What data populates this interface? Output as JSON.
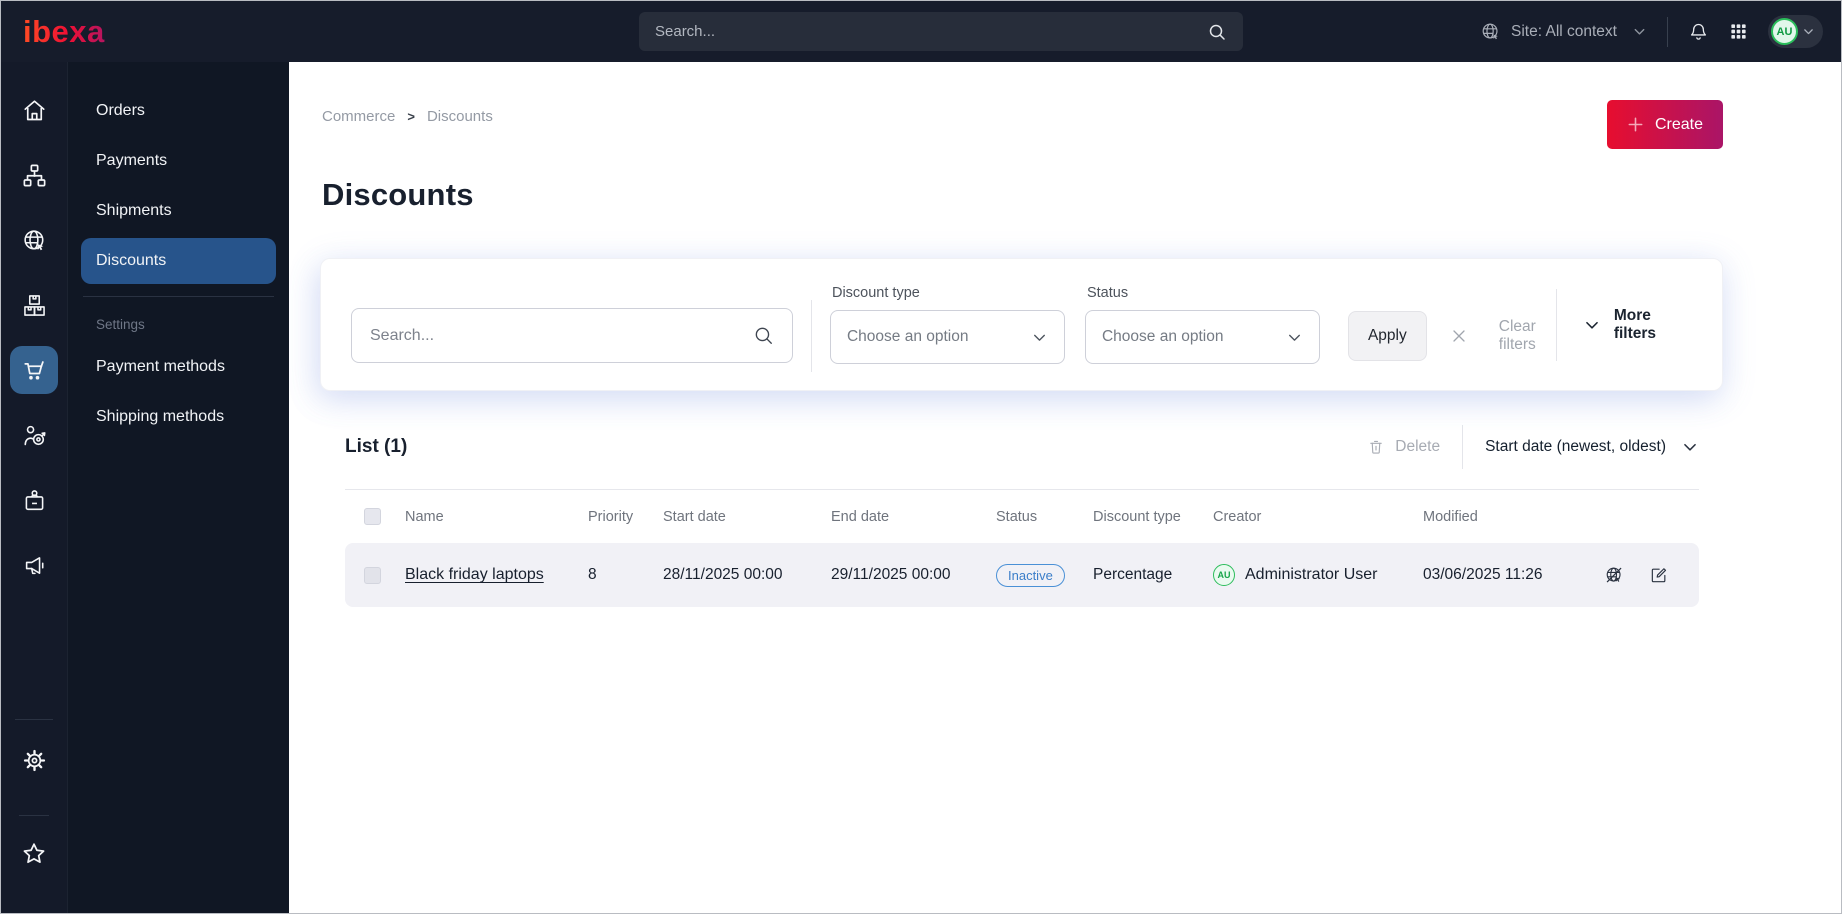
{
  "topbar": {
    "logo_text": "ibexa",
    "search": {
      "placeholder": "Search..."
    },
    "site_context": {
      "label": "Site: All context"
    },
    "avatar_initials": "AU"
  },
  "menu": {
    "items": [
      {
        "label": "Orders"
      },
      {
        "label": "Payments"
      },
      {
        "label": "Shipments"
      },
      {
        "label": "Discounts"
      }
    ],
    "section_label": "Settings",
    "settings_items": [
      {
        "label": "Payment methods"
      },
      {
        "label": "Shipping methods"
      }
    ]
  },
  "breadcrumb": {
    "items": [
      "Commerce",
      "Discounts"
    ],
    "separator": ">"
  },
  "page": {
    "title": "Discounts",
    "create_label": "Create"
  },
  "filters": {
    "search_placeholder": "Search...",
    "discount_type": {
      "label": "Discount type",
      "value": "Choose an option"
    },
    "status": {
      "label": "Status",
      "value": "Choose an option"
    },
    "apply_label": "Apply",
    "clear_label": "Clear filters",
    "more_label": "More filters"
  },
  "list": {
    "title": "List (1)",
    "delete_label": "Delete",
    "sort_label": "Start date (newest, oldest)",
    "columns": [
      "Name",
      "Priority",
      "Start date",
      "End date",
      "Status",
      "Discount type",
      "Creator",
      "Modified"
    ],
    "rows": [
      {
        "name": "Black friday laptops",
        "priority": "8",
        "start_date": "28/11/2025 00:00",
        "end_date": "29/11/2025 00:00",
        "status": "Inactive",
        "discount_type": "Percentage",
        "creator": "Administrator User",
        "creator_initials": "AU",
        "modified": "03/06/2025 11:26"
      }
    ]
  },
  "icons": {
    "rail": [
      "home-icon",
      "content-tree-icon",
      "site-globe-icon",
      "products-boxes-icon",
      "commerce-cart-icon",
      "personalization-target-icon",
      "admin-badge-icon",
      "marketing-megaphone-icon",
      "settings-gear-icon",
      "bookmarks-star-icon"
    ],
    "row_actions": [
      "site-preview-disabled-icon",
      "edit-icon"
    ]
  },
  "colors": {
    "topbar_bg": "#161c2b",
    "rail_bg": "#141a29",
    "menu_bg": "#101724",
    "active_menu_blue": "#27548b",
    "active_rail_blue": "#35628f",
    "create_gradient_start": "#e70e2f",
    "create_gradient_end": "#aa1567",
    "badge_blue": "#4a90d6",
    "avatar_green": "#2cbd5b",
    "row_bg": "#f1f1f6"
  }
}
